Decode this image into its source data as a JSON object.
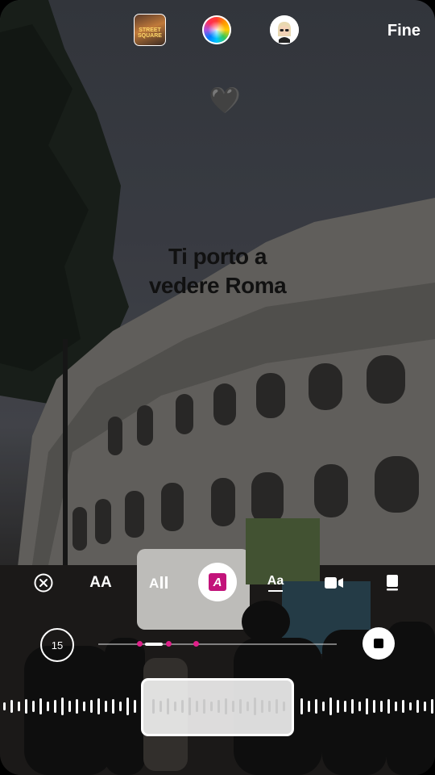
{
  "topbar": {
    "thumbnail_label": "STREET SQUARE",
    "done_label": "Fine"
  },
  "sticker": {
    "heart_glyph": "🖤"
  },
  "caption": {
    "line1": "Ti porto a",
    "line2": "vedere Roma"
  },
  "tools": {
    "font_size_label": "AA",
    "effect_label": "Aa",
    "highlight_label": "A"
  },
  "timeline": {
    "duration": "15",
    "highlight_color": "#c2137a",
    "marker_color": "#e0208a"
  },
  "icons": [
    "close-icon",
    "text-align-icon",
    "video-icon",
    "sticker-icon",
    "stop-icon"
  ]
}
